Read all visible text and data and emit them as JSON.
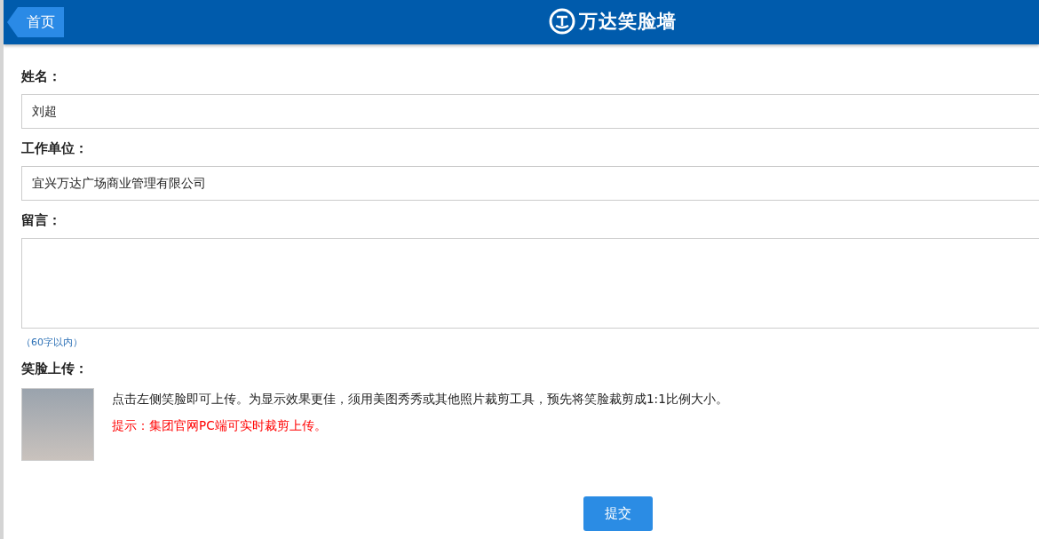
{
  "header": {
    "back_button": "首页",
    "logo_text": "万达笑脸墙"
  },
  "form": {
    "fields": [
      {
        "kind": "input",
        "label": "姓名：",
        "value": "刘超"
      },
      {
        "kind": "input",
        "label": "工作单位：",
        "value": "宜兴万达广场商业管理有限公司"
      },
      {
        "kind": "textarea",
        "label": "留言：",
        "note": "（60字以内）"
      }
    ]
  },
  "upload": {
    "label": "笑脸上传：",
    "instruction": "点击左侧笑脸即可上传。为显示效果更佳，须用美图秀秀或其他照片裁剪工具，预先将笑脸裁剪成1:1比例大小。",
    "hint": "提示：集团官网PC端可实时裁剪上传。"
  },
  "submit_button": "提交"
}
